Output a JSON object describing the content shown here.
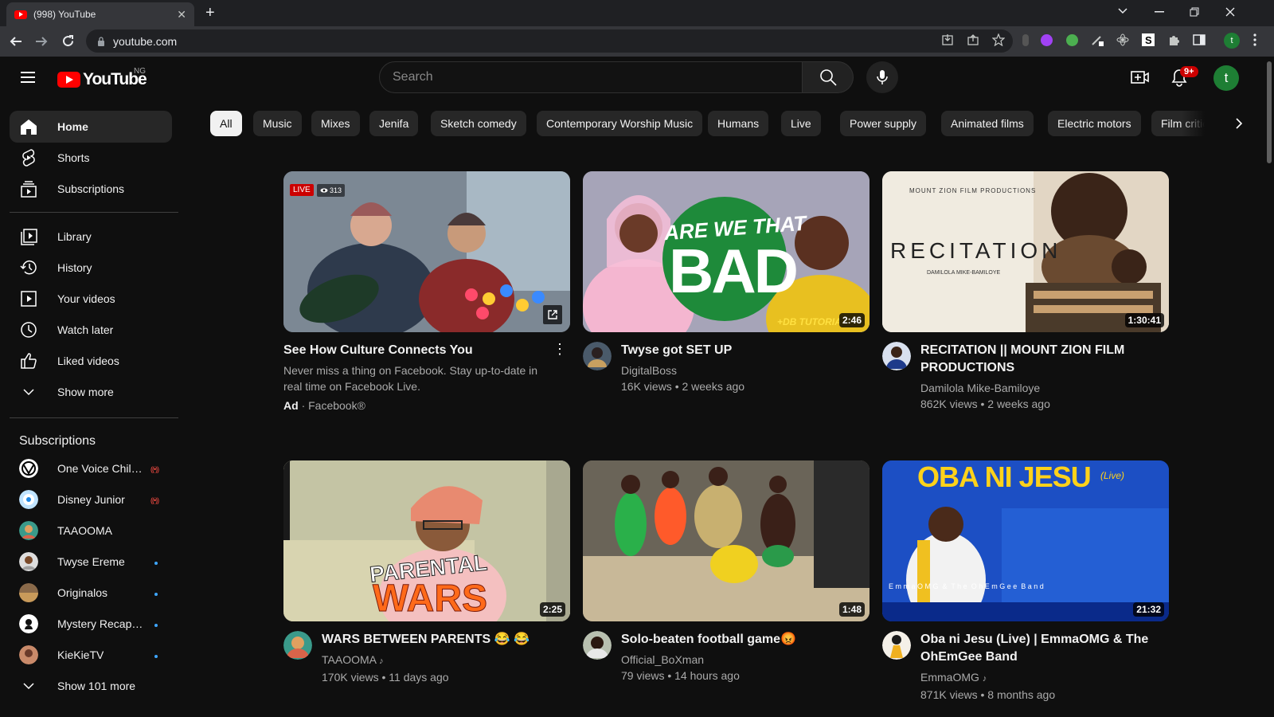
{
  "browser": {
    "tab_title": "(998) YouTube",
    "tab_close": "✕",
    "new_tab": "+",
    "url": "youtube.com"
  },
  "masthead": {
    "logo_text": "YouTube",
    "country_code": "NG",
    "search_placeholder": "Search",
    "notification_count": "9+",
    "avatar_letter": "t"
  },
  "sidebar": {
    "main": [
      {
        "label": "Home",
        "icon": "home-icon"
      },
      {
        "label": "Shorts",
        "icon": "shorts-icon"
      },
      {
        "label": "Subscriptions",
        "icon": "subscriptions-icon"
      }
    ],
    "library": [
      {
        "label": "Library",
        "icon": "library-icon"
      },
      {
        "label": "History",
        "icon": "history-icon"
      },
      {
        "label": "Your videos",
        "icon": "your-videos-icon"
      },
      {
        "label": "Watch later",
        "icon": "watch-later-icon"
      },
      {
        "label": "Liked videos",
        "icon": "liked-videos-icon"
      },
      {
        "label": "Show more",
        "icon": "chevron-down-icon"
      }
    ],
    "subscriptions_heading": "Subscriptions",
    "subscriptions": [
      {
        "label": "One Voice Children's Choir",
        "indicator": "live"
      },
      {
        "label": "Disney Junior",
        "indicator": "live"
      },
      {
        "label": "TAAOOMA",
        "indicator": "none"
      },
      {
        "label": "Twyse Ereme",
        "indicator": "new"
      },
      {
        "label": "Originalos",
        "indicator": "new"
      },
      {
        "label": "Mystery Recapped",
        "indicator": "new"
      },
      {
        "label": "KieKieTV",
        "indicator": "new"
      }
    ],
    "show_more_subs": "Show 101 more"
  },
  "chips": [
    "All",
    "Music",
    "Mixes",
    "Jenifa",
    "Sketch comedy",
    "Contemporary Worship Music",
    "Humans",
    "Live",
    "Power supply",
    "Animated films",
    "Electric motors",
    "Film critic"
  ],
  "videos": [
    {
      "title": "See How Culture Connects You",
      "description": "Never miss a thing on Facebook. Stay up-to-date in real time on Facebook Live.",
      "ad_label": "Ad",
      "advertiser": "· Facebook®",
      "live_badge": "LIVE",
      "viewers": "313",
      "menu": "⋮"
    },
    {
      "title": "Twyse got SET UP",
      "channel": "DigitalBoss",
      "stats": "16K views • 2 weeks ago",
      "duration": "2:46",
      "thumb_text_1": "ARE WE THAT",
      "thumb_text_2": "BAD",
      "thumb_text_3": "+DB TUTORIA"
    },
    {
      "title": "RECITATION || MOUNT ZION FILM PRODUCTIONS",
      "channel": "Damilola Mike-Bamiloye",
      "stats": "862K views • 2 weeks ago",
      "duration": "1:30:41",
      "thumb_text_1": "MOUNT ZION FILM PRODUCTIONS",
      "thumb_text_2": "RECITATION",
      "thumb_text_3": "DAMILOLA MIKE-BAMILOYE"
    },
    {
      "title": "WARS BETWEEN PARENTS 😂 😂",
      "channel": "TAAOOMA",
      "stats": "170K views • 11 days ago",
      "duration": "2:25",
      "thumb_text_1": "PARENTAL",
      "thumb_text_2": "WARS"
    },
    {
      "title": "Solo-beaten football game😡",
      "channel": "Official_BoXman",
      "stats": "79 views • 14 hours ago",
      "duration": "1:48"
    },
    {
      "title": "Oba ni Jesu (Live) | EmmaOMG & The OhEmGee Band",
      "channel": "EmmaOMG",
      "stats": "871K views • 8 months ago",
      "duration": "21:32",
      "thumb_text_1": "OBA NI JESU",
      "thumb_text_2": "(Live)",
      "thumb_text_3": "E m m a O M G  &  T h e  O h E m G e e  B a n d"
    }
  ],
  "colors": {
    "background": "#0f0f0f",
    "brand_red": "#ff0000",
    "chip_bg": "#272727",
    "text_secondary": "#aaaaaa"
  }
}
